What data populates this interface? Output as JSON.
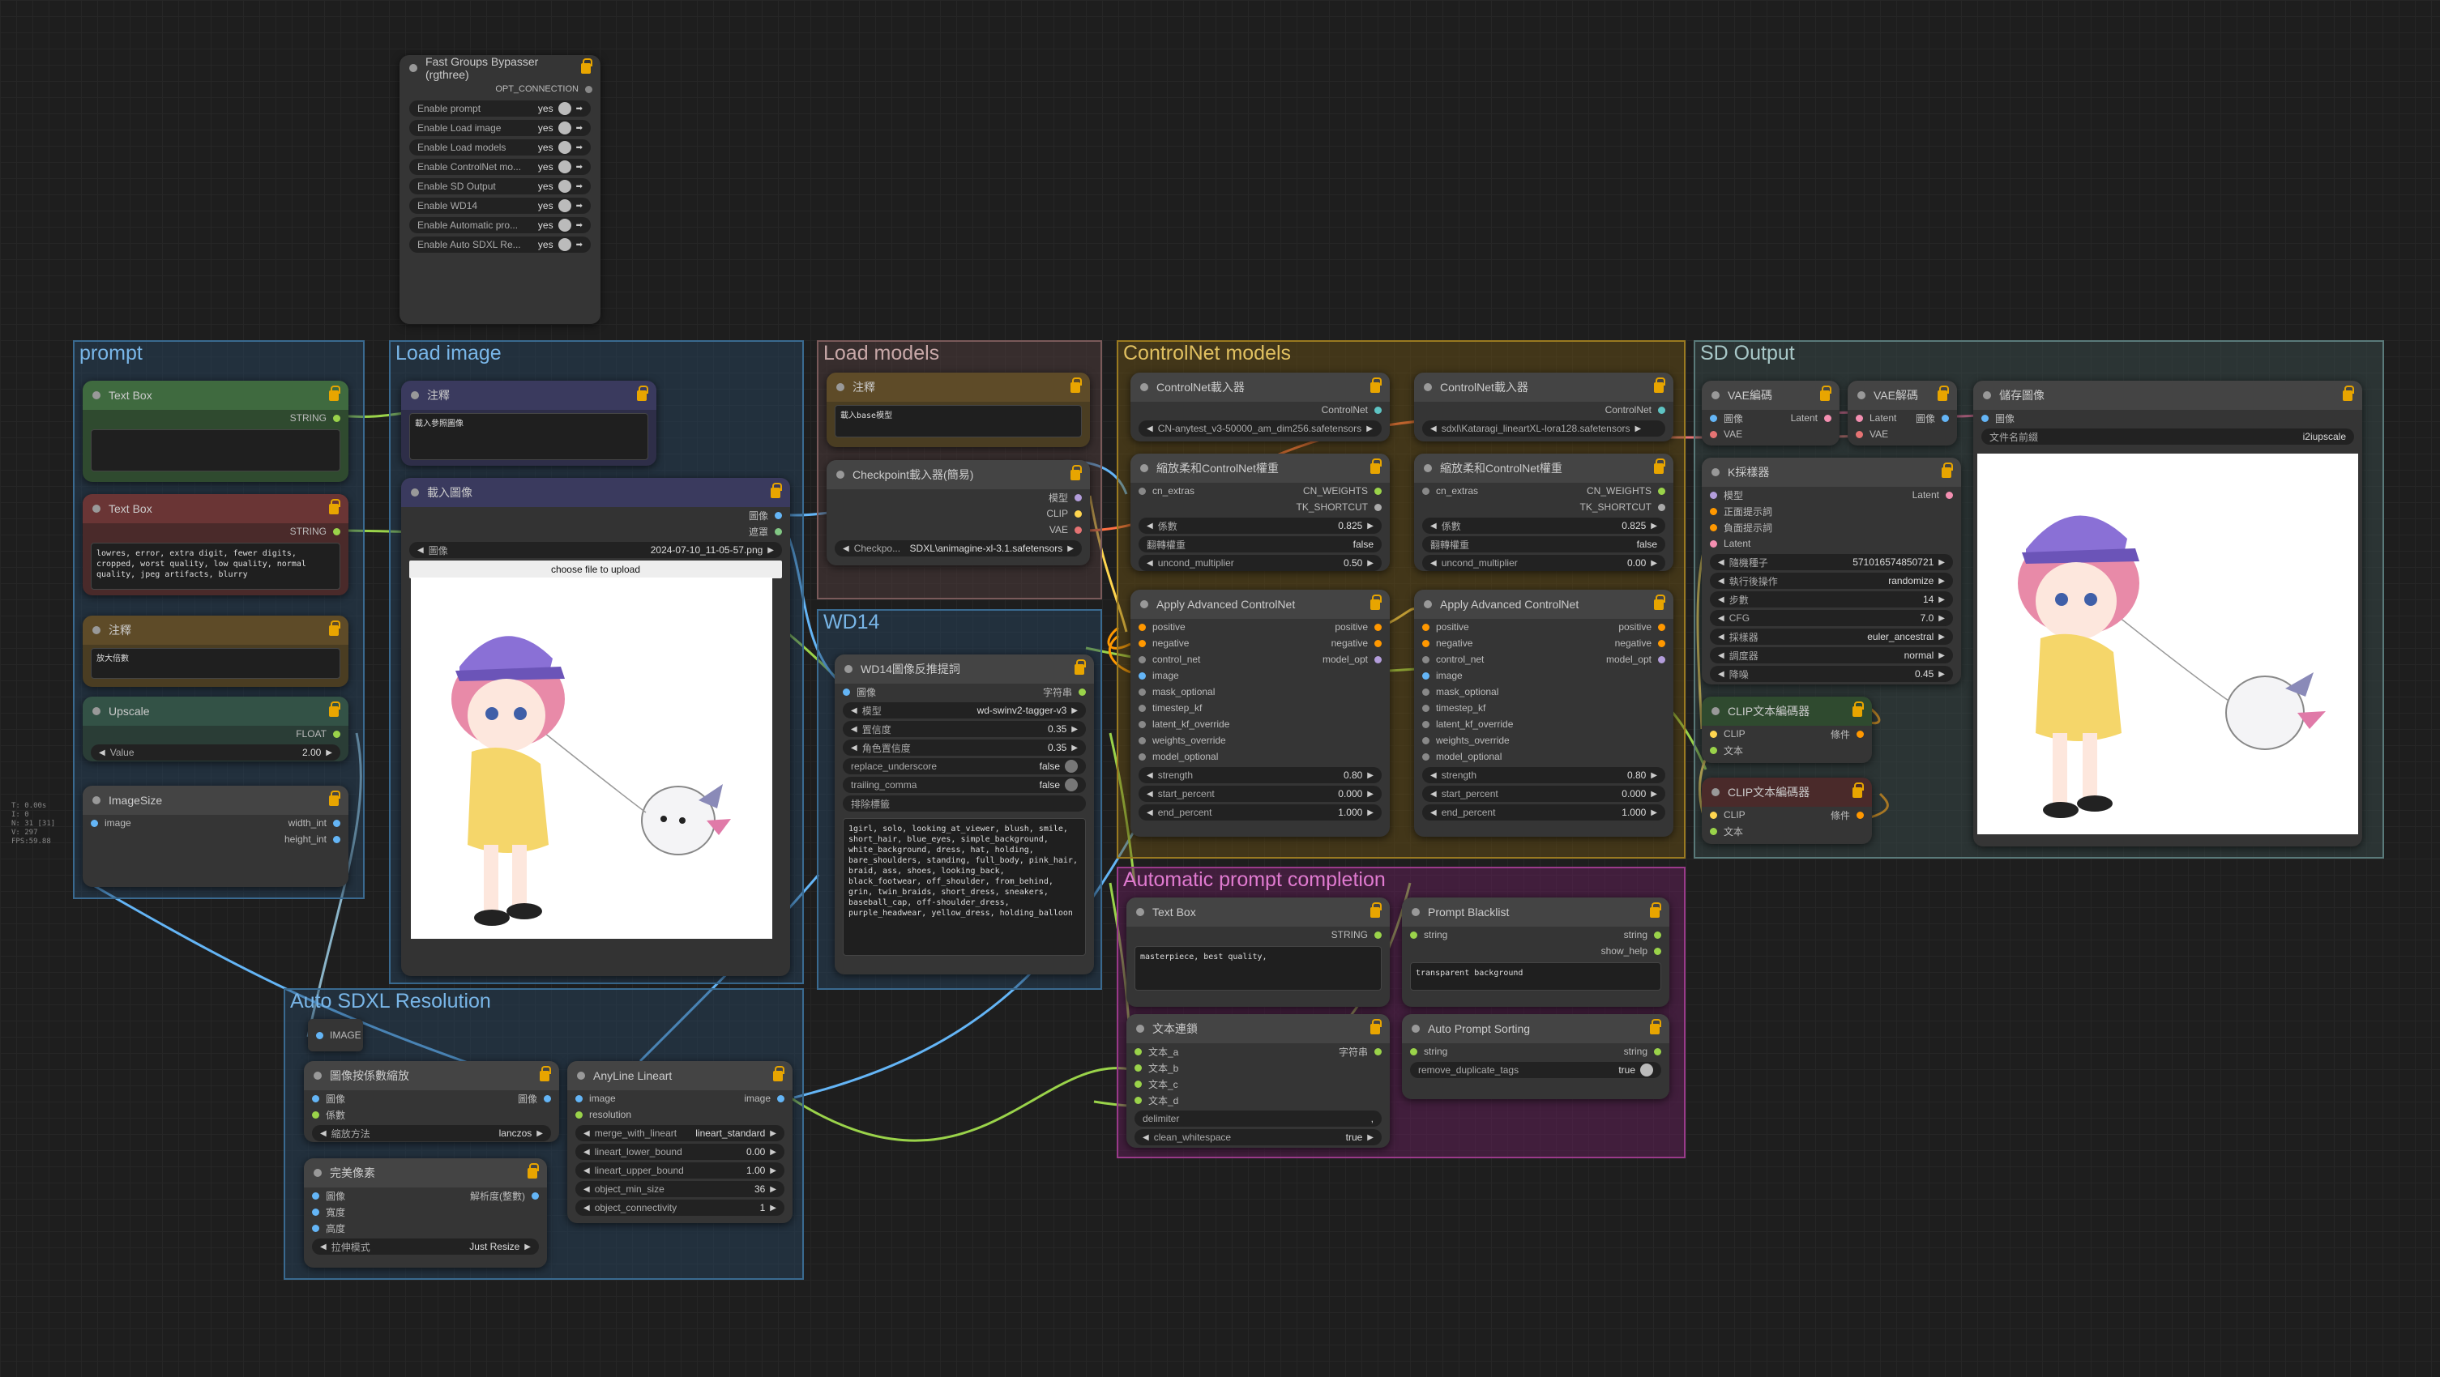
{
  "colors": {
    "accent_lock": "#e8a500",
    "bg": "#1e1e1e"
  },
  "stats": {
    "line1": "T: 0.00s",
    "line2": "I: 0",
    "line3": "N: 31 [31]",
    "line4": "V: 297",
    "line5": "FPS:59.88"
  },
  "bypasser": {
    "title": "Fast Groups Bypasser (rgthree)",
    "opt": "OPT_CONNECTION",
    "items": [
      {
        "label": "Enable prompt",
        "value": "yes"
      },
      {
        "label": "Enable Load image",
        "value": "yes"
      },
      {
        "label": "Enable Load models",
        "value": "yes"
      },
      {
        "label": "Enable ControlNet mo...",
        "value": "yes"
      },
      {
        "label": "Enable SD Output",
        "value": "yes"
      },
      {
        "label": "Enable WD14",
        "value": "yes"
      },
      {
        "label": "Enable Automatic pro...",
        "value": "yes"
      },
      {
        "label": "Enable Auto SDXL Re...",
        "value": "yes"
      }
    ]
  },
  "groups": {
    "prompt": "prompt",
    "load_image": "Load image",
    "load_models": "Load models",
    "controlnet": "ControlNet models",
    "sd_output": "SD Output",
    "wd14": "WD14",
    "auto_prompt": "Automatic prompt completion",
    "auto_sdxl": "Auto SDXL Resolution"
  },
  "prompt": {
    "tb1": {
      "title": "Text Box",
      "out": "STRING"
    },
    "tb2": {
      "title": "Text Box",
      "out": "STRING",
      "text": "lowres, error, extra digit, fewer digits, cropped, worst quality, low quality, normal quality, jpeg artifacts, blurry"
    },
    "note": {
      "title": "注釋",
      "text": "放大倍數"
    },
    "upscale": {
      "title": "Upscale",
      "out": "FLOAT",
      "label": "Value",
      "value": "2.00"
    },
    "imagesize": {
      "title": "ImageSize",
      "in": "image",
      "out1": "width_int",
      "out2": "height_int"
    }
  },
  "loadimage": {
    "note_title": "注釋",
    "note_text": "載入參照圖像",
    "node_title": "載入圖像",
    "out_image": "圖像",
    "out_mask": "遮罩",
    "label": "圖像",
    "file": "2024-07-10_11-05-57.png",
    "upload": "choose file to upload"
  },
  "loadmodels": {
    "note_title": "注釋",
    "note_text": "載入base模型",
    "ckpt_title": "Checkpoint載入器(簡易)",
    "out1": "模型",
    "out2": "CLIP",
    "out3": "VAE",
    "ckpt_label": "Checkpo...",
    "ckpt_value": "SDXL\\animagine-xl-3.1.safetensors"
  },
  "wd14": {
    "title": "WD14圖像反推提詞",
    "in": "圖像",
    "out": "字符串",
    "model_label": "模型",
    "model": "wd-swinv2-tagger-v3",
    "thr_label": "置信度",
    "thr": "0.35",
    "cthr_label": "角色置信度",
    "cthr": "0.35",
    "ru_label": "replace_underscore",
    "ru": "false",
    "te_label": "trailing_comma",
    "te": "false",
    "ex_label": "排除標籤",
    "tags": "1girl, solo, looking_at_viewer, blush, smile, short_hair, blue_eyes, simple_background, white_background, dress, hat, holding, bare_shoulders, standing, full_body, pink_hair, braid, ass, shoes, looking_back, black_footwear, off_shoulder, from_behind, grin, twin_braids, short_dress, sneakers, baseball_cap, off-shoulder_dress, purple_headwear, yellow_dress, holding_balloon"
  },
  "controlnet": {
    "loader_title": "ControlNet載入器",
    "out": "ControlNet",
    "file1": "CN-anytest_v3-50000_am_dim256.safetensors",
    "file2": "sdxl\\Kataragi_lineartXL-lora128.safetensors",
    "scale_title": "縮放柔和ControlNet權重",
    "in": "cn_extras",
    "out1": "CN_WEIGHTS",
    "out2": "TK_SHORTCUT",
    "base_label": "係數",
    "base": "0.825",
    "flip_label": "翻轉權重",
    "flip": "false",
    "uncond_label": "uncond_multiplier",
    "uncond1": "0.50",
    "uncond2": "0.00",
    "apply_title": "Apply Advanced ControlNet",
    "in_list": [
      "positive",
      "negative",
      "control_net",
      "image",
      "mask_optional",
      "timestep_kf",
      "latent_kf_override",
      "weights_override",
      "model_optional"
    ],
    "out_list": [
      "positive",
      "negative",
      "model_opt"
    ],
    "strength_label": "strength",
    "strength": "0.80",
    "start_label": "start_percent",
    "start": "0.000",
    "end_label": "end_percent",
    "end": "1.000"
  },
  "sd": {
    "vaeenc": {
      "title": "VAE編碼",
      "in1": "圖像",
      "in2": "VAE",
      "out": "Latent"
    },
    "vaedec": {
      "title": "VAE解碼",
      "in1": "Latent",
      "in2": "VAE",
      "out": "圖像"
    },
    "save": {
      "title": "儲存圖像",
      "in": "圖像",
      "label": "文件名前綴",
      "value": "i2iupscale"
    },
    "ksampler": {
      "title": "K採樣器",
      "in": [
        "模型",
        "正面提示詞",
        "負面提示詞",
        "Latent"
      ],
      "out": "Latent",
      "widgets": [
        {
          "l": "隨機種子",
          "v": "571016574850721"
        },
        {
          "l": "執行後操作",
          "v": "randomize"
        },
        {
          "l": "步數",
          "v": "14"
        },
        {
          "l": "CFG",
          "v": "7.0"
        },
        {
          "l": "採樣器",
          "v": "euler_ancestral"
        },
        {
          "l": "調度器",
          "v": "normal"
        },
        {
          "l": "降噪",
          "v": "0.45"
        }
      ]
    },
    "clip": {
      "title": "CLIP文本編碼器",
      "in1": "CLIP",
      "in2": "文本",
      "out": "條件"
    }
  },
  "autoprompt": {
    "tb": {
      "title": "Text Box",
      "out": "STRING",
      "text": "masterpiece, best quality,"
    },
    "bl": {
      "title": "Prompt Blacklist",
      "in": "string",
      "out1": "string",
      "out2": "show_help",
      "text": "transparent background"
    },
    "concat": {
      "title": "文本連鎖",
      "in": [
        "文本_a",
        "文本_b",
        "文本_c",
        "文本_d"
      ],
      "out": "字符串",
      "w1": "delimiter",
      "w1v": ",",
      "w2": "clean_whitespace",
      "w2v": "true"
    },
    "sort": {
      "title": "Auto Prompt Sorting",
      "in": "string",
      "out": "string",
      "w": "remove_duplicate_tags",
      "wv": "true"
    }
  },
  "sdxl": {
    "image": "IMAGE",
    "scale": {
      "title": "圖像按係數縮放",
      "in1": "圖像",
      "in2": "係數",
      "out": "圖像",
      "w": "縮放方法",
      "wv": "lanczos"
    },
    "perfect": {
      "title": "完美像素",
      "in": [
        "圖像",
        "寬度",
        "高度"
      ],
      "out": "解析度(整數)",
      "w": "拉伸模式",
      "wv": "Just Resize"
    },
    "anyline": {
      "title": "AnyLine Lineart",
      "in1": "image",
      "in2": "resolution",
      "out": "image",
      "widgets": [
        {
          "l": "merge_with_lineart",
          "v": "lineart_standard"
        },
        {
          "l": "lineart_lower_bound",
          "v": "0.00"
        },
        {
          "l": "lineart_upper_bound",
          "v": "1.00"
        },
        {
          "l": "object_min_size",
          "v": "36"
        },
        {
          "l": "object_connectivity",
          "v": "1"
        }
      ]
    }
  }
}
